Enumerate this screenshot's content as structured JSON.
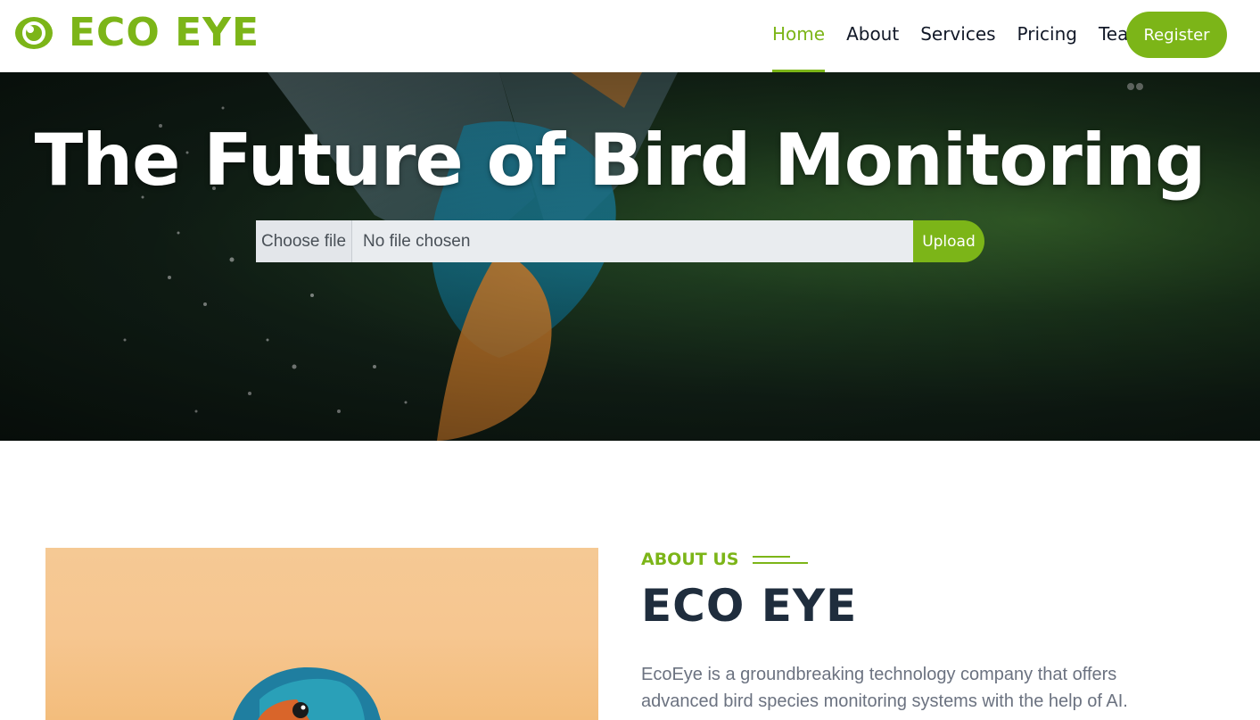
{
  "header": {
    "logo_text": "ECO EYE",
    "logo_icon": "eye-icon",
    "nav": [
      {
        "label": "Home",
        "active": true
      },
      {
        "label": "About",
        "active": false
      },
      {
        "label": "Services",
        "active": false
      },
      {
        "label": "Pricing",
        "active": false
      },
      {
        "label": "Team",
        "active": false
      }
    ],
    "register_label": "Register"
  },
  "hero": {
    "title": "The Future of Bird Monitoring",
    "choose_file_label": "Choose file",
    "no_file_text": "No file chosen",
    "upload_label": "Upload"
  },
  "about": {
    "label": "ABOUT US",
    "title": "ECO EYE",
    "description": "EcoEye is a groundbreaking technology company that offers advanced bird species monitoring systems with the help of AI."
  },
  "colors": {
    "accent": "#7cb518",
    "heading": "#1f2d3d",
    "hero_background": "#132319"
  }
}
